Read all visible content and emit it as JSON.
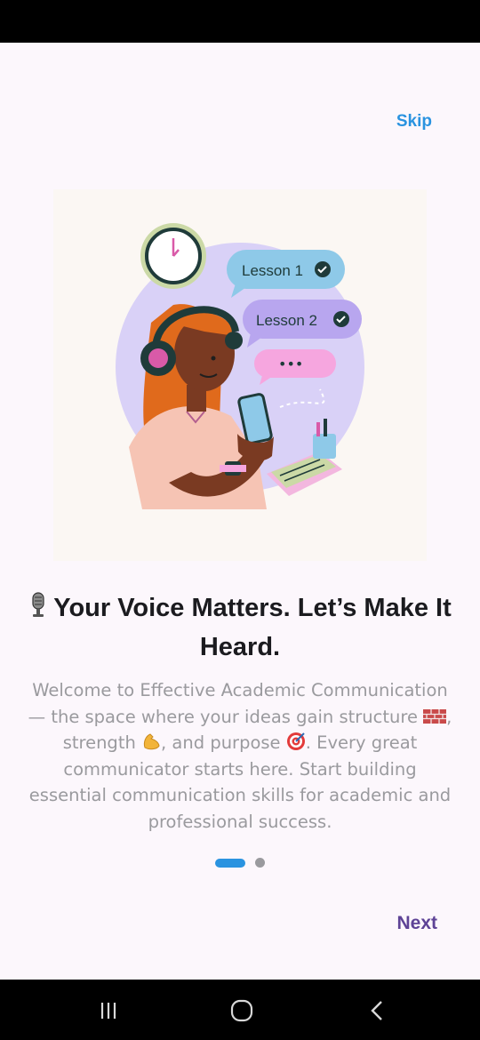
{
  "header": {
    "skip_label": "Skip"
  },
  "illustration": {
    "bubble_1": "Lesson 1",
    "bubble_2": "Lesson 2",
    "bubble_3": "•••"
  },
  "content": {
    "title": "Your Voice Matters. Let’s Make It Heard.",
    "desc_1": "Welcome to Effective Academic Communication — the space where your ideas gain structure ",
    "desc_2": ", strength ",
    "desc_3": ", and purpose ",
    "desc_4": ". Every great communicator starts here. Start building essential communication skills for academic and professional success."
  },
  "pager": {
    "page_count": 2,
    "active_page": 1
  },
  "footer": {
    "next_label": "Next"
  },
  "colors": {
    "accent": "#2a93e0",
    "next": "#5e4396",
    "text_muted": "#9a9a9e",
    "background": "#fcf7fc"
  },
  "icons": {
    "title": "microphone-icon",
    "desc": [
      "brick-icon",
      "flexed-biceps-icon",
      "target-icon"
    ],
    "nav": [
      "recent-apps-icon",
      "home-icon",
      "back-icon"
    ]
  }
}
